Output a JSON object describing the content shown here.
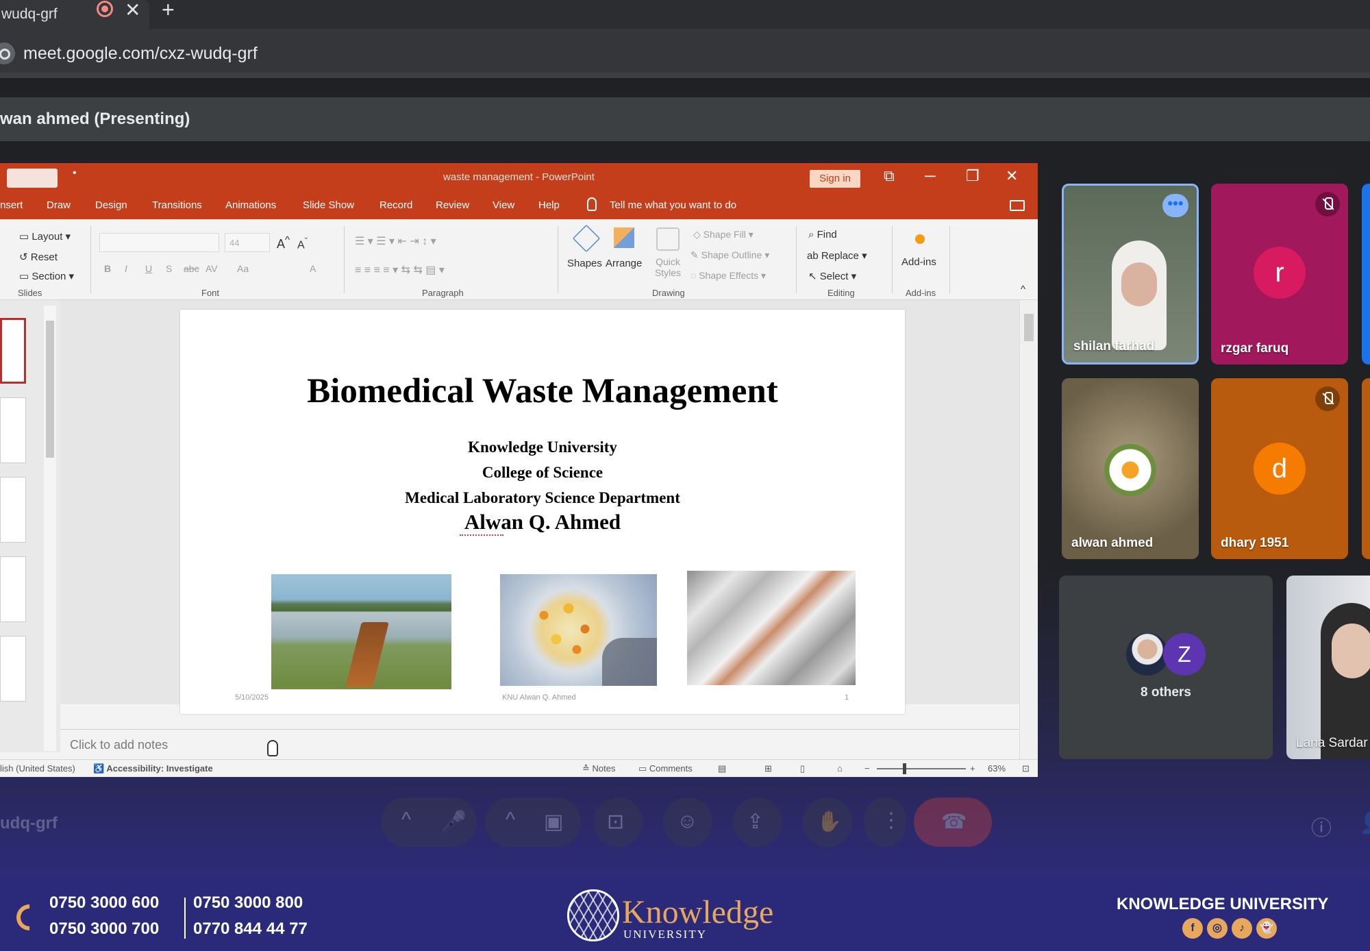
{
  "browser": {
    "tab_title": "wudq-grf",
    "tab_close": "✕",
    "new_tab": "+",
    "url": "meet.google.com/cxz-wudq-grf"
  },
  "meet": {
    "presenting_label": "wan ahmed (Presenting)",
    "meeting_code": "udq-grf",
    "participants": [
      {
        "name": "shilan farhad",
        "muted": false
      },
      {
        "name": "rzgar faruq",
        "initial": "r",
        "muted": true
      },
      {
        "name": "alwan ahmed",
        "muted": false
      },
      {
        "name": "dhary 1951",
        "initial": "d",
        "muted": true
      },
      {
        "name": "8 others",
        "initial": "Z"
      },
      {
        "name": "Lana Sardar"
      }
    ],
    "more_glyph": "•••",
    "controls": [
      "caret",
      "mic",
      "caret",
      "camera",
      "captions",
      "emoji",
      "present",
      "hand",
      "more",
      "end-call",
      "info",
      "people"
    ]
  },
  "powerpoint": {
    "window_title": "waste management  -  PowerPoint",
    "sign_in": "Sign in",
    "win_buttons": [
      "⧉",
      "─",
      "❐",
      "✕"
    ],
    "menu": [
      "nsert",
      "Draw",
      "Design",
      "Transitions",
      "Animations",
      "Slide Show",
      "Record",
      "Review",
      "View",
      "Help"
    ],
    "tell_me": "Tell me what you want to do",
    "ribbon": {
      "slides_group": {
        "layout": "Layout",
        "reset": "Reset",
        "section": "Section",
        "label": "Slides"
      },
      "font_group": {
        "size": "44",
        "label": "Font",
        "buttons": [
          "B",
          "I",
          "U",
          "S",
          "abc",
          "AV",
          "Aa",
          "A"
        ]
      },
      "paragraph_group": {
        "label": "Paragraph"
      },
      "drawing_group": {
        "shapes": "Shapes",
        "arrange": "Arrange",
        "quick_styles": "Quick Styles",
        "shape_fill": "Shape Fill",
        "shape_outline": "Shape Outline",
        "shape_effects": "Shape Effects",
        "label": "Drawing"
      },
      "editing_group": {
        "find": "Find",
        "replace": "Replace",
        "select": "Select",
        "label": "Editing"
      },
      "addins_group": {
        "addins": "Add-ins",
        "label": "Add-ins"
      }
    },
    "slide": {
      "title": "Biomedical Waste Management",
      "lines": [
        "Knowledge University",
        "College of Science",
        "Medical Laboratory Science Department"
      ],
      "author": "Alwan Q. Ahmed",
      "footer_date": "5/10/2025",
      "footer_text": "KNU Alwan Q. Ahmed",
      "footer_page": "1"
    },
    "notes_placeholder": "Click to add notes",
    "status": {
      "language": "lish (United States)",
      "accessibility": "Accessibility: Investigate",
      "notes": "Notes",
      "comments": "Comments",
      "zoom": "63%"
    }
  },
  "footer": {
    "phones": [
      "0750 3000 600",
      "0750 3000 800",
      "0750 3000 700",
      "0770 844 44 77"
    ],
    "logo_word": "Knowledge",
    "logo_sub": "UNIVERSITY",
    "brand": "KNOWLEDGE UNIVERSITY",
    "socials": [
      "f",
      "◎",
      "♪",
      "👻"
    ],
    "accent": "#e8a85b",
    "bg": "#2b2a7a"
  }
}
